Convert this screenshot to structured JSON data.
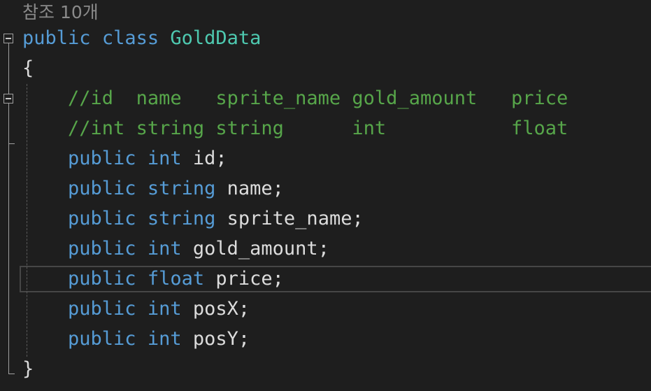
{
  "codelens": "참조 10개",
  "lines": [
    [
      {
        "t": "public",
        "c": "kw"
      },
      {
        "t": " "
      },
      {
        "t": "class",
        "c": "kw"
      },
      {
        "t": " "
      },
      {
        "t": "GoldData",
        "c": "type"
      }
    ],
    [
      {
        "t": "{"
      }
    ],
    [
      {
        "t": "    "
      },
      {
        "t": "//id  name   sprite_name gold_amount   price",
        "c": "cmt"
      }
    ],
    [
      {
        "t": "    "
      },
      {
        "t": "//int string string      int           float",
        "c": "cmt"
      }
    ],
    [
      {
        "t": "    "
      },
      {
        "t": "public",
        "c": "kw"
      },
      {
        "t": " "
      },
      {
        "t": "int",
        "c": "kw"
      },
      {
        "t": " id;"
      }
    ],
    [
      {
        "t": "    "
      },
      {
        "t": "public",
        "c": "kw"
      },
      {
        "t": " "
      },
      {
        "t": "string",
        "c": "kw"
      },
      {
        "t": " name;"
      }
    ],
    [
      {
        "t": "    "
      },
      {
        "t": "public",
        "c": "kw"
      },
      {
        "t": " "
      },
      {
        "t": "string",
        "c": "kw"
      },
      {
        "t": " sprite_name;"
      }
    ],
    [
      {
        "t": "    "
      },
      {
        "t": "public",
        "c": "kw"
      },
      {
        "t": " "
      },
      {
        "t": "int",
        "c": "kw"
      },
      {
        "t": " gold_amount;"
      }
    ],
    [
      {
        "t": "    "
      },
      {
        "t": "public",
        "c": "kw"
      },
      {
        "t": " "
      },
      {
        "t": "float",
        "c": "kw"
      },
      {
        "t": " price;"
      }
    ],
    [
      {
        "t": "    "
      },
      {
        "t": "public",
        "c": "kw"
      },
      {
        "t": " "
      },
      {
        "t": "int",
        "c": "kw"
      },
      {
        "t": " posX;"
      }
    ],
    [
      {
        "t": "    "
      },
      {
        "t": "public",
        "c": "kw"
      },
      {
        "t": " "
      },
      {
        "t": "int",
        "c": "kw"
      },
      {
        "t": " posY;"
      }
    ],
    [
      {
        "t": "}"
      }
    ]
  ],
  "colors": {
    "background": "#1e1e1e",
    "keyword": "#569cd6",
    "type": "#4ec9b0",
    "comment": "#57a64a",
    "text": "#dcdcdc"
  }
}
